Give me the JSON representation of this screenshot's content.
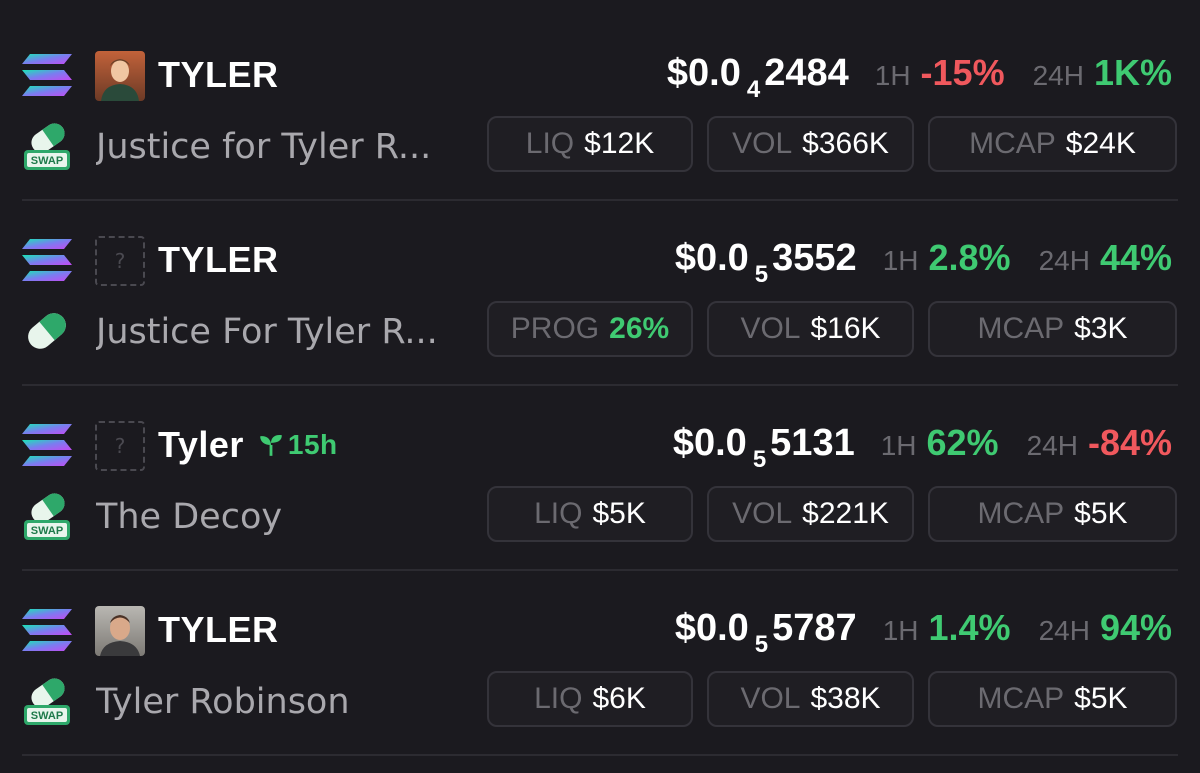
{
  "tokens": [
    {
      "ticker": "TYLER",
      "avatar": "photo-young-man",
      "dex_icon": "swap-pill-icon",
      "name": "Justice for Tyler R...",
      "price_prefix": "$0.0",
      "price_zeros": "4",
      "price_digits": "2484",
      "h1_label": "1H",
      "h1_value": "-15%",
      "h24_label": "24H",
      "h24_value": "1K%",
      "stats": [
        {
          "label": "LIQ",
          "value": "$12K"
        },
        {
          "label": "VOL",
          "value": "$366K"
        },
        {
          "label": "MCAP",
          "value": "$24K"
        }
      ]
    },
    {
      "ticker": "TYLER",
      "avatar": "placeholder",
      "avatar_text": "?",
      "dex_icon": "pill-icon",
      "name": "Justice For Tyler R...",
      "price_prefix": "$0.0",
      "price_zeros": "5",
      "price_digits": "3552",
      "h1_label": "1H",
      "h1_value": "2.8%",
      "h24_label": "24H",
      "h24_value": "44%",
      "stats": [
        {
          "label": "PROG",
          "value": "26%"
        },
        {
          "label": "VOL",
          "value": "$16K"
        },
        {
          "label": "MCAP",
          "value": "$3K"
        }
      ]
    },
    {
      "ticker": "Tyler",
      "age": "15h",
      "avatar": "placeholder",
      "avatar_text": "?",
      "dex_icon": "swap-pill-icon",
      "name": "The Decoy",
      "price_prefix": "$0.0",
      "price_zeros": "5",
      "price_digits": "5131",
      "h1_label": "1H",
      "h1_value": "62%",
      "h24_label": "24H",
      "h24_value": "-84%",
      "stats": [
        {
          "label": "LIQ",
          "value": "$5K"
        },
        {
          "label": "VOL",
          "value": "$221K"
        },
        {
          "label": "MCAP",
          "value": "$5K"
        }
      ]
    },
    {
      "ticker": "TYLER",
      "avatar": "photo-mugshot",
      "dex_icon": "swap-pill-icon",
      "name": "Tyler Robinson",
      "price_prefix": "$0.0",
      "price_zeros": "5",
      "price_digits": "5787",
      "h1_label": "1H",
      "h1_value": "1.4%",
      "h24_label": "24H",
      "h24_value": "94%",
      "stats": [
        {
          "label": "LIQ",
          "value": "$6K"
        },
        {
          "label": "VOL",
          "value": "$38K"
        },
        {
          "label": "MCAP",
          "value": "$5K"
        }
      ]
    }
  ],
  "colors": {
    "background": "#1b1a1f",
    "positive": "#3fca72",
    "negative": "#f0585d",
    "muted": "#6b6a70",
    "card_border": "#34333a"
  }
}
